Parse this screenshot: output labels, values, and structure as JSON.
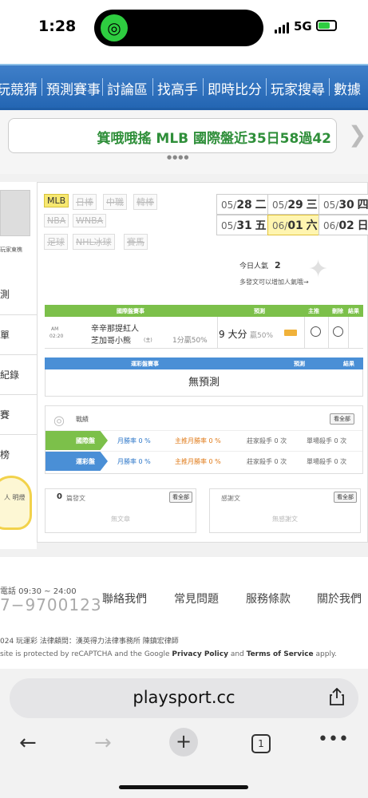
{
  "status": {
    "time": "1:28",
    "network": "5G"
  },
  "nav": [
    "玩競猜",
    "預測賽事",
    "討論區",
    "找高手",
    "即時比分",
    "玩家搜尋",
    "數據"
  ],
  "ticker": {
    "text": "箕哦哦搖 MLB 國際盤近35日58過42"
  },
  "user": {
    "name": "玩家東樵"
  },
  "left_menu": [
    "測",
    "單",
    "紀錄",
    "賽",
    "榜"
  ],
  "bulb_text": "人 明燈",
  "leagues": [
    {
      "label": "MLB",
      "active": true
    },
    {
      "label": "日棒",
      "active": false
    },
    {
      "label": "中職",
      "active": false
    },
    {
      "label": "韓棒",
      "active": false
    },
    {
      "label": "NBA",
      "active": false
    },
    {
      "label": "WNBA",
      "active": false
    },
    {
      "label": "足球",
      "active": false
    },
    {
      "label": "NHL冰球",
      "active": false
    },
    {
      "label": "賽馬",
      "active": false
    }
  ],
  "dates": [
    {
      "md": "05/",
      "d": "28",
      "w": "二",
      "selected": false
    },
    {
      "md": "05/",
      "d": "29",
      "w": "三",
      "selected": false
    },
    {
      "md": "05/",
      "d": "30",
      "w": "四",
      "selected": false
    },
    {
      "md": "05/",
      "d": "31",
      "w": "五",
      "selected": false
    },
    {
      "md": "06/",
      "d": "01",
      "w": "六",
      "selected": true
    },
    {
      "md": "06/",
      "d": "02",
      "w": "日",
      "selected": false
    }
  ],
  "popularity": {
    "label": "今日人氣",
    "value": "2",
    "hint": "多發文可以增加人氣哦→"
  },
  "intl_table": {
    "headers": [
      "國際盤賽事",
      "預測",
      "主推",
      "刪除",
      "結果"
    ],
    "row": {
      "ampm": "AM",
      "time": "02:20",
      "team1": "辛辛那提紅人",
      "team2": "芝加哥小熊",
      "team2_tag": "(主)",
      "spread": "1分贏50%",
      "pick": "9 大分",
      "pick_pct": "贏50%"
    }
  },
  "lottery_table": {
    "headers": [
      "運彩盤賽事",
      "預測",
      "結果"
    ],
    "empty": "無預測"
  },
  "stats": {
    "title": "戰績",
    "view_all": "看全部",
    "rows": [
      {
        "label": "國際盤",
        "color": "#7cc04a",
        "month": "月勝率 0 %",
        "main": "主推月勝率 0 %",
        "killer": "莊家殺手 0 次",
        "single": "單場殺手 0 次"
      },
      {
        "label": "運彩盤",
        "color": "#4a8fd6",
        "month": "月勝率 0 %",
        "main": "主推月勝率 0 %",
        "killer": "莊家殺手 0 次",
        "single": "單場殺手 0 次"
      }
    ]
  },
  "posts": {
    "count": "0",
    "label": "篇發文",
    "view_all": "看全部",
    "empty": "無文章"
  },
  "thanks": {
    "label": "感謝文",
    "view_all": "看全部",
    "empty": "無感謝文"
  },
  "footer": {
    "phone_label": "電話 09:30 ~ 24:00",
    "phone": "7−9700123",
    "links": [
      "聯絡我們",
      "常見問題",
      "服務條款",
      "關於我們"
    ],
    "copyright": "024 玩運彩 法律顧問：漢英得力法律事務所 陳鎮宏律師",
    "recaptcha_pre": "site is protected by reCAPTCHA and the Google ",
    "privacy": "Privacy Policy",
    "and": " and ",
    "terms": "Terms of Service",
    "apply": " apply."
  },
  "browser": {
    "url": "playsport.cc",
    "tabs": "1"
  }
}
